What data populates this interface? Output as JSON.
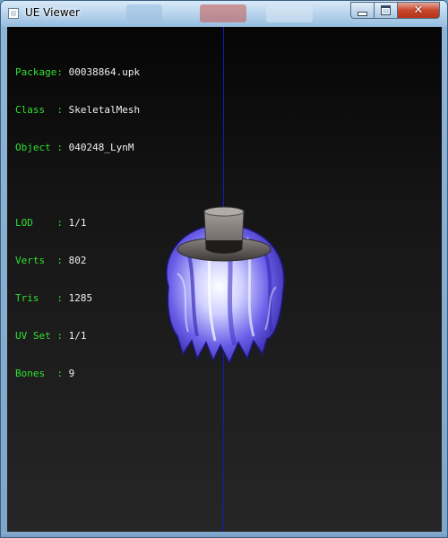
{
  "window": {
    "title": "UE Viewer"
  },
  "info": {
    "package_label": "Package:",
    "package_value": "00038864.upk",
    "class_label": "Class  :",
    "class_value": "SkeletalMesh",
    "object_label": "Object :",
    "object_value": "040248_LynM",
    "lod_label": "LOD    :",
    "lod_value": "1/1",
    "verts_label": "Verts  :",
    "verts_value": "802",
    "tris_label": "Tris   :",
    "tris_value": "1285",
    "uvset_label": "UV Set :",
    "uvset_value": "1/1",
    "bones_label": "Bones  :",
    "bones_value": "9"
  },
  "colors": {
    "label_green": "#32e032",
    "value_white": "#f0f0f0",
    "axis_blue": "#1515c8",
    "hair_purple": "#5a4fd8",
    "hat_gray": "#7a7572"
  },
  "icons": {
    "app": "window-app-icon",
    "minimize": "minimize-icon",
    "maximize": "maximize-icon",
    "close": "close-icon"
  }
}
